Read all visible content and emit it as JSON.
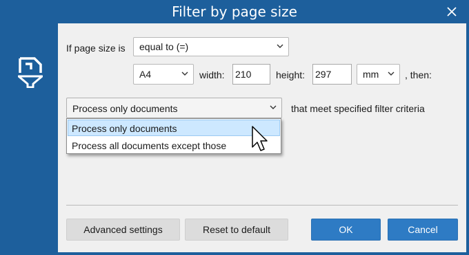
{
  "window": {
    "title": "Filter by page size",
    "accent_color": "#1d5f9c",
    "icons": {
      "close": "close-icon",
      "logo": "page-filter-logo-icon"
    }
  },
  "form": {
    "page_size_label": "If page size is",
    "comparison": {
      "selected": "equal to (=)"
    },
    "paper": {
      "selected": "A4"
    },
    "width_label": "width:",
    "width_value": "210",
    "height_label": "height:",
    "height_value": "297",
    "unit": {
      "selected": "mm"
    },
    "then_label": ", then:",
    "action": {
      "selected": "Process only documents",
      "suffix": "that meet specified filter criteria",
      "options": [
        "Process only documents",
        "Process all documents except those"
      ],
      "highlighted_index": 0
    }
  },
  "buttons": {
    "advanced": "Advanced settings",
    "reset": "Reset to default",
    "ok": "OK",
    "cancel": "Cancel"
  }
}
